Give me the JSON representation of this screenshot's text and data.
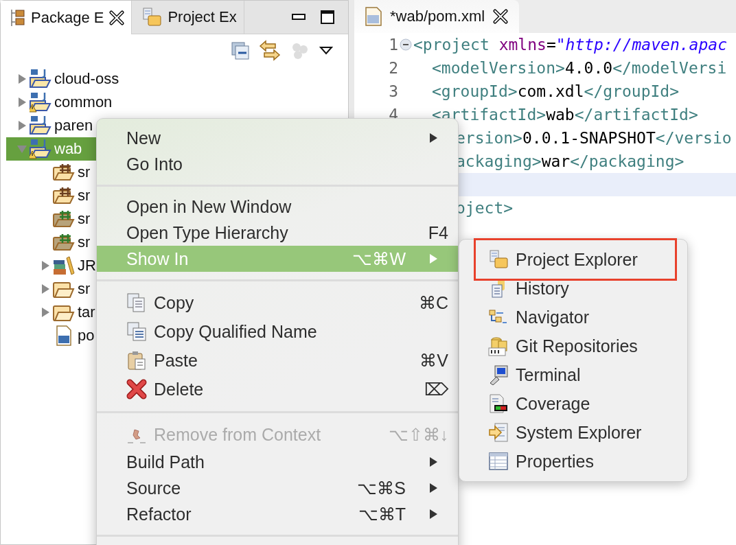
{
  "left_panel": {
    "tabs": [
      {
        "label": "Package E",
        "kind": "package",
        "selected": true,
        "closable": true
      },
      {
        "label": "Project Ex",
        "kind": "project",
        "selected": false,
        "closable": false
      }
    ],
    "tree": [
      {
        "label": "cloud-oss",
        "kind": "project",
        "expanded": false,
        "warning": false,
        "selected": false
      },
      {
        "label": "common",
        "kind": "project",
        "expanded": false,
        "warning": true,
        "selected": false
      },
      {
        "label": "paren",
        "kind": "project",
        "expanded": false,
        "warning": false,
        "selected": false
      },
      {
        "label": "wab",
        "kind": "project",
        "expanded": true,
        "warning": true,
        "selected": true,
        "children": [
          {
            "label": "sr",
            "kind": "source",
            "selected": false
          },
          {
            "label": "sr",
            "kind": "source",
            "selected": false
          },
          {
            "label": "sr",
            "kind": "test-source",
            "selected": false
          },
          {
            "label": "sr",
            "kind": "test-source",
            "selected": false
          },
          {
            "label": "JR",
            "kind": "library",
            "expanded": false,
            "selected": false
          },
          {
            "label": "sr",
            "kind": "folder",
            "expanded": false,
            "selected": false
          },
          {
            "label": "tar",
            "kind": "folder",
            "expanded": false,
            "selected": false
          },
          {
            "label": "po",
            "kind": "pom",
            "selected": false
          }
        ]
      }
    ]
  },
  "editor": {
    "tab": {
      "label": "*wab/pom.xml"
    },
    "lines": [
      {
        "number": "1",
        "foldable": true,
        "current": false,
        "segments": [
          {
            "kind": "tag",
            "text": "<project "
          },
          {
            "kind": "attr",
            "text": "xmlns"
          },
          {
            "kind": "plain",
            "text": "="
          },
          {
            "kind": "value",
            "text": "\"http://maven.apac"
          }
        ],
        "children": [
          {
            "number": "2",
            "current": false,
            "segments": [
              {
                "kind": "tag",
                "text": "<modelVersion>"
              },
              {
                "kind": "plain",
                "text": "4.0.0"
              },
              {
                "kind": "tag",
                "text": "</modelVersi"
              }
            ]
          },
          {
            "number": "3",
            "current": false,
            "segments": [
              {
                "kind": "tag",
                "text": "<groupId>"
              },
              {
                "kind": "plain",
                "text": "com.xdl"
              },
              {
                "kind": "tag",
                "text": "</groupId>"
              }
            ]
          },
          {
            "number": "4",
            "current": false,
            "segments": [
              {
                "kind": "tag",
                "text": "<artifactId>"
              },
              {
                "kind": "plain",
                "text": "wab"
              },
              {
                "kind": "tag",
                "text": "</artifactId>"
              }
            ]
          },
          {
            "current": false,
            "segments": [
              {
                "kind": "tag",
                "text": "ersion>"
              },
              {
                "kind": "plain",
                "text": "0.0.1-SNAPSHOT"
              },
              {
                "kind": "tag",
                "text": "</versio"
              }
            ]
          },
          {
            "current": false,
            "segments": [
              {
                "kind": "tag",
                "text": "ackaging>"
              },
              {
                "kind": "plain",
                "text": "war"
              },
              {
                "kind": "tag",
                "text": "</packaging>"
              }
            ]
          },
          {
            "current": true
          }
        ]
      },
      {
        "current": false,
        "segments": [
          {
            "kind": "tag",
            "text": "oject>"
          }
        ]
      }
    ]
  },
  "context_menu": {
    "items": [
      {
        "kind": "plain",
        "label": "New",
        "submenu": true,
        "disabled": false,
        "selected": false
      },
      {
        "kind": "plain",
        "label": "Go Into",
        "submenu": false,
        "disabled": false,
        "selected": false
      },
      {
        "kind": "separator"
      },
      {
        "kind": "plain",
        "label": "Open in New Window",
        "submenu": false,
        "disabled": false,
        "selected": false
      },
      {
        "kind": "plain",
        "label": "Open Type Hierarchy",
        "shortcut": "F4",
        "submenu": false,
        "disabled": false,
        "selected": false
      },
      {
        "kind": "plain",
        "label": "Show In",
        "shortcut": "⌥⌘W",
        "submenu": true,
        "disabled": false,
        "selected": true
      },
      {
        "kind": "separator"
      },
      {
        "kind": "copy",
        "label": "Copy",
        "shortcut": "⌘C",
        "submenu": false,
        "disabled": false,
        "selected": false
      },
      {
        "kind": "duplicate",
        "label": "Copy Qualified Name",
        "submenu": false,
        "disabled": false,
        "selected": false
      },
      {
        "kind": "paste",
        "label": "Paste",
        "shortcut": "⌘V",
        "submenu": false,
        "disabled": false,
        "selected": false
      },
      {
        "kind": "delete",
        "label": "Delete",
        "shortcut": "⌦",
        "submenu": false,
        "disabled": false,
        "selected": false
      },
      {
        "kind": "separator"
      },
      {
        "kind": "remove",
        "label": "Remove from Context",
        "shortcut": "⌥⇧⌘↓",
        "submenu": false,
        "disabled": true,
        "selected": false
      },
      {
        "kind": "plain",
        "label": "Build Path",
        "submenu": true,
        "disabled": false,
        "selected": false
      },
      {
        "kind": "plain",
        "label": "Source",
        "shortcut": "⌥⌘S",
        "submenu": true,
        "disabled": false,
        "selected": false
      },
      {
        "kind": "plain",
        "label": "Refactor",
        "shortcut": "⌥⌘T",
        "submenu": true,
        "disabled": false,
        "selected": false
      },
      {
        "kind": "separator"
      }
    ]
  },
  "show_in_menu": {
    "items": [
      {
        "label": "Project Explorer",
        "kind": "project",
        "highlighted": true
      },
      {
        "label": "History",
        "kind": "history",
        "highlighted": false
      },
      {
        "label": "Navigator",
        "kind": "navigator",
        "highlighted": false
      },
      {
        "label": "Git Repositories",
        "kind": "git",
        "highlighted": false
      },
      {
        "label": "Terminal",
        "kind": "terminal",
        "highlighted": false
      },
      {
        "label": "Coverage",
        "kind": "coverage",
        "highlighted": false
      },
      {
        "label": "System Explorer",
        "kind": "system",
        "highlighted": false
      },
      {
        "label": "Properties",
        "kind": "properties",
        "highlighted": false
      }
    ]
  }
}
